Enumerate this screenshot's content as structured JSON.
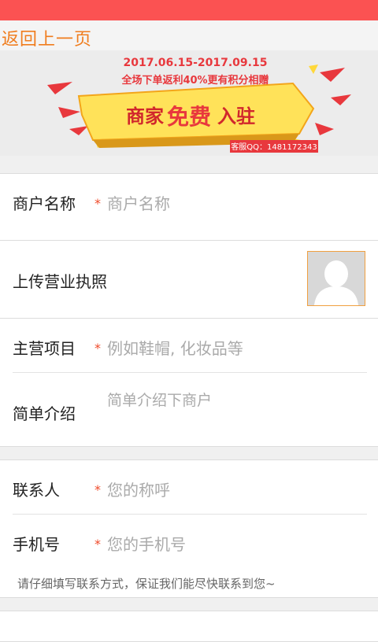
{
  "nav": {
    "back_label": "返回上一页"
  },
  "banner": {
    "date_range": "2017.06.15-2017.09.15",
    "promo_text": "全场下单返利40%更有积分相赠",
    "headline_part1": "商家",
    "headline_highlight": "免费",
    "headline_part2": "入驻",
    "service_qq": "客服QQ：1481172343",
    "colors": {
      "accent_red": "#e8383d",
      "yellow": "#ffd83a",
      "ribbon": "#ffe259"
    }
  },
  "form": {
    "merchant_name": {
      "label": "商户名称",
      "required_mark": "*",
      "placeholder": "商户名称"
    },
    "license": {
      "label": "上传营业执照",
      "thumbnail_icon": "avatar-placeholder-icon"
    },
    "main_business": {
      "label": "主营项目",
      "required_mark": "*",
      "placeholder": "例如鞋帽, 化妆品等"
    },
    "intro": {
      "label": "简单介绍",
      "placeholder": "简单介绍下商户"
    },
    "contact": {
      "label": "联系人",
      "required_mark": "*",
      "placeholder": "您的称呼"
    },
    "phone": {
      "label": "手机号",
      "required_mark": "*",
      "placeholder": "您的手机号"
    },
    "contact_hint": "请仔细填写联系方式，保证我们能尽快联系到您~"
  },
  "theme": {
    "status_bar": "#fb5252",
    "back_link": "#f07d1e",
    "required": "#f04a2a"
  }
}
